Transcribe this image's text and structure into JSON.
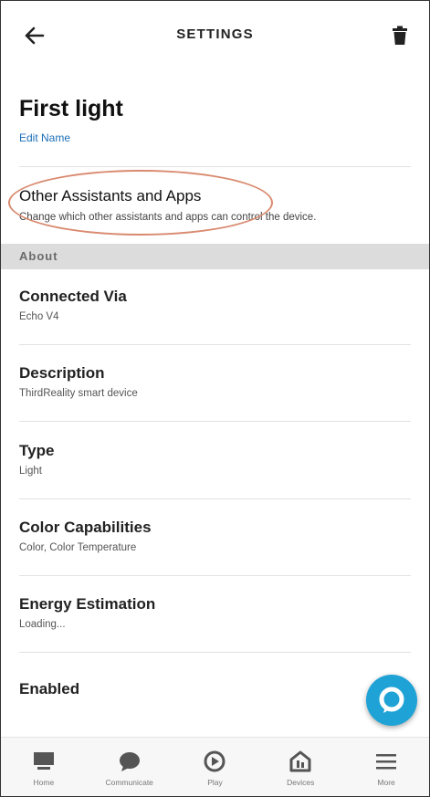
{
  "header": {
    "title": "SETTINGS",
    "back_icon": "back-arrow-icon",
    "delete_icon": "trash-icon"
  },
  "device": {
    "name": "First light",
    "edit_label": "Edit Name"
  },
  "other_assistants": {
    "title": "Other Assistants and Apps",
    "subtitle": "Change which other assistants and apps can control the device."
  },
  "about": {
    "section_label": "About",
    "rows": [
      {
        "title": "Connected Via",
        "value": "Echo V4"
      },
      {
        "title": "Description",
        "value": "ThirdReality smart device"
      },
      {
        "title": "Type",
        "value": "Light"
      },
      {
        "title": "Color Capabilities",
        "value": "Color, Color Temperature"
      },
      {
        "title": "Energy Estimation",
        "value": "Loading..."
      },
      {
        "title": "Enabled",
        "value": ""
      }
    ]
  },
  "fab_icon": "alexa-icon",
  "bottom_nav": [
    {
      "label": "Home",
      "icon": "home-icon"
    },
    {
      "label": "Communicate",
      "icon": "chat-bubble-icon"
    },
    {
      "label": "Play",
      "icon": "play-icon"
    },
    {
      "label": "Devices",
      "icon": "devices-icon"
    },
    {
      "label": "More",
      "icon": "menu-icon"
    }
  ],
  "colors": {
    "link": "#1d6fb8",
    "section_bg": "#dcdcdc",
    "fab": "#1fa3d6",
    "highlight": "#d98a6f"
  }
}
